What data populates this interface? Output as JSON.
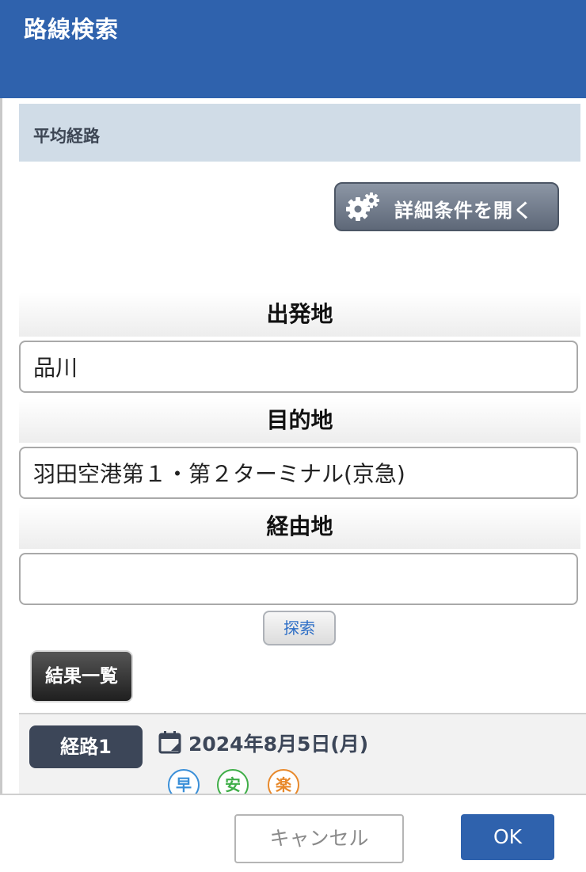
{
  "header": {
    "title": "路線検索"
  },
  "section": {
    "title": "平均経路"
  },
  "detail_button": {
    "label": "詳細条件を開く",
    "icon": "gear-icon"
  },
  "fields": {
    "departure": {
      "label": "出発地",
      "value": "品川"
    },
    "destination": {
      "label": "目的地",
      "value": "羽田空港第１・第２ターミナル(京急)"
    },
    "via": {
      "label": "経由地",
      "value": ""
    }
  },
  "search_button": {
    "label": "探索"
  },
  "results_tab": {
    "label": "結果一覧"
  },
  "results": {
    "route_label": "経路1",
    "date": "2024年8月5日(月)",
    "marks": [
      {
        "label": "早",
        "color": "#3a8fd8"
      },
      {
        "label": "安",
        "color": "#3fae48"
      },
      {
        "label": "楽",
        "color": "#e8892b"
      }
    ]
  },
  "footer": {
    "cancel_label": "キャンセル",
    "ok_label": "OK"
  },
  "colors": {
    "primary": "#2f62ad",
    "section_bg": "#d0dce7",
    "badge": "#3c4658"
  }
}
